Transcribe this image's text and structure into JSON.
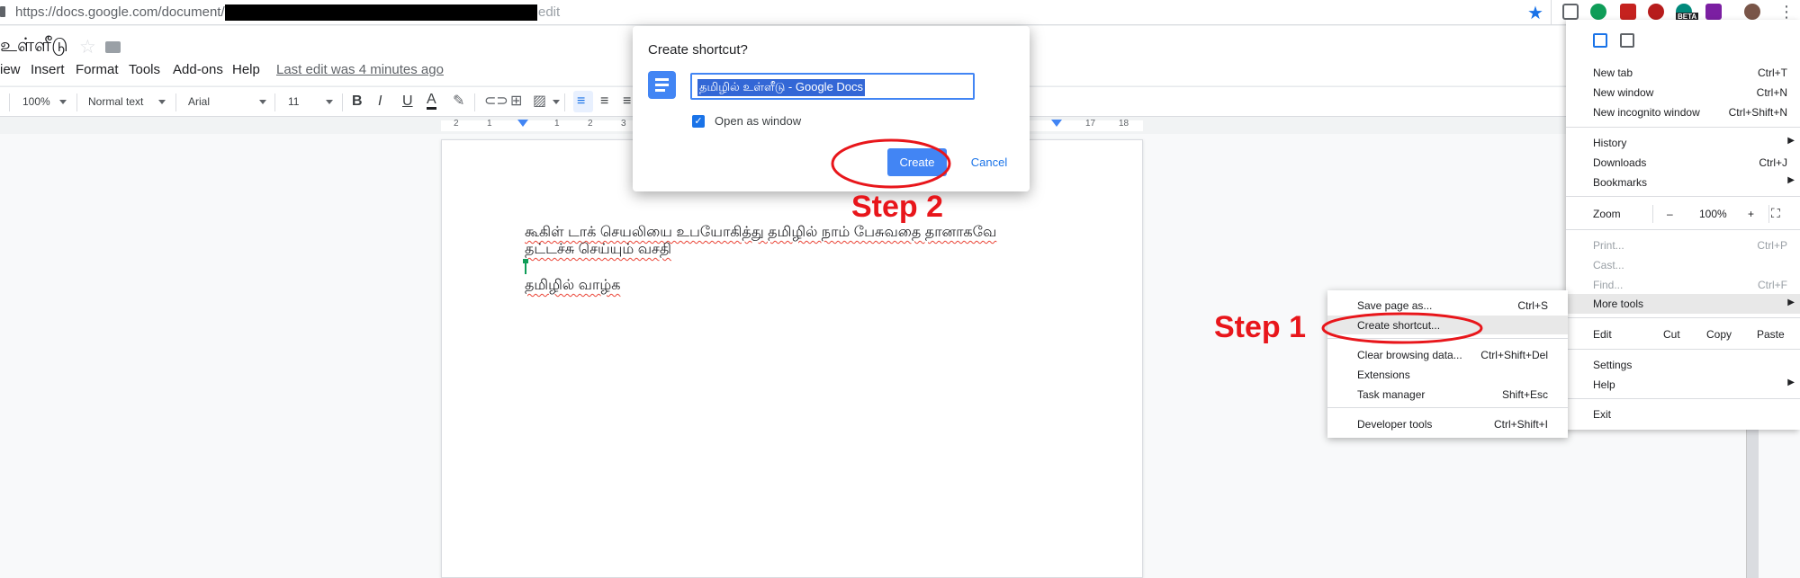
{
  "browser": {
    "url_prefix": "https://docs.google.com/document/d/",
    "url_suffix": "edit",
    "beta_badge": "BETA"
  },
  "docs": {
    "title": "உள்ளீடு",
    "menu": {
      "view": "iew",
      "insert": "Insert",
      "format": "Format",
      "tools": "Tools",
      "addons": "Add-ons",
      "help": "Help",
      "last_edit": "Last edit was 4 minutes ago"
    },
    "toolbar": {
      "zoom": "100%",
      "style": "Normal text",
      "font": "Arial",
      "size": "11"
    },
    "ruler": {
      "labels": [
        "2",
        "1",
        "1",
        "2",
        "3",
        "17",
        "18"
      ]
    },
    "content": {
      "line1": "கூகிள் டாக் செயலியை உபயோகித்து தமிழில் நாம் பேசுவதை தானாகவே",
      "line2": "தட்டச்சு செய்யும் வசதி",
      "line3": "தமிழில் வாழ்க"
    }
  },
  "dialog": {
    "title": "Create shortcut?",
    "input_value": "தமிழில் உள்ளீடு - Google Docs",
    "checkbox_label": "Open as window",
    "create": "Create",
    "cancel": "Cancel"
  },
  "chrome_menu": {
    "new_tab": {
      "label": "New tab",
      "shortcut": "Ctrl+T"
    },
    "new_window": {
      "label": "New window",
      "shortcut": "Ctrl+N"
    },
    "new_incognito": {
      "label": "New incognito window",
      "shortcut": "Ctrl+Shift+N"
    },
    "history": "History",
    "downloads": {
      "label": "Downloads",
      "shortcut": "Ctrl+J"
    },
    "bookmarks": "Bookmarks",
    "zoom": {
      "label": "Zoom",
      "minus": "–",
      "value": "100%",
      "plus": "+"
    },
    "print": {
      "label": "Print...",
      "shortcut": "Ctrl+P"
    },
    "cast": "Cast...",
    "find": {
      "label": "Find...",
      "shortcut": "Ctrl+F"
    },
    "more_tools": "More tools",
    "edit": {
      "label": "Edit",
      "cut": "Cut",
      "copy": "Copy",
      "paste": "Paste"
    },
    "settings": "Settings",
    "help": "Help",
    "exit": "Exit"
  },
  "more_tools_menu": {
    "save_page": {
      "label": "Save page as...",
      "shortcut": "Ctrl+S"
    },
    "create_shortcut": "Create shortcut...",
    "clear_browsing": {
      "label": "Clear browsing data...",
      "shortcut": "Ctrl+Shift+Del"
    },
    "extensions": "Extensions",
    "task_manager": {
      "label": "Task manager",
      "shortcut": "Shift+Esc"
    },
    "developer_tools": {
      "label": "Developer tools",
      "shortcut": "Ctrl+Shift+I"
    }
  },
  "annotations": {
    "step1": "Step 1",
    "step2": "Step 2",
    "color": "#e8161b"
  },
  "colors": {
    "accent": "#4285f4",
    "link": "#1a73e8"
  }
}
